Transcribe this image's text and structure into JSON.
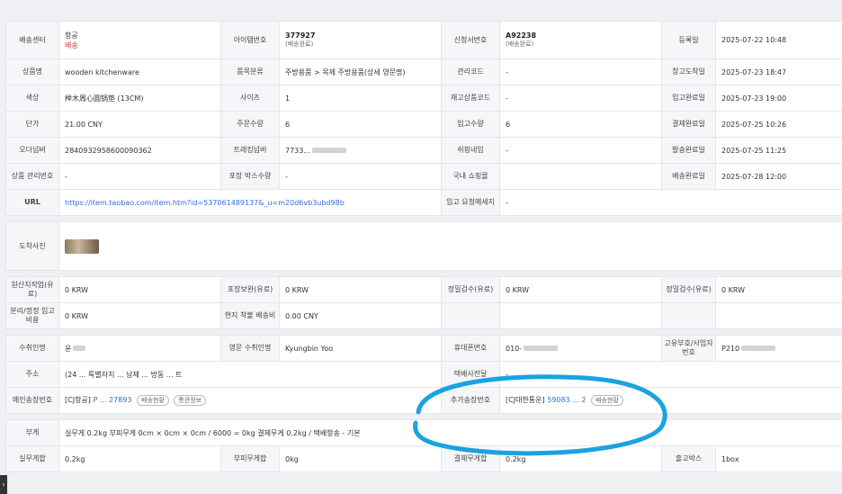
{
  "row1": {
    "center_label": "배송센터",
    "center_v1": "항공",
    "center_v2": "배송",
    "item_label": "아이템번호",
    "item_no": "377927",
    "item_status": "(배송완료)",
    "order_label": "신청서번호",
    "order_no": "A92238",
    "order_status": "(배송완료)",
    "reg_label": "등록일",
    "reg_value": "2025-07-22 10:48"
  },
  "row2": {
    "l1": "상품명",
    "v1": "wooden kitchenware",
    "l2": "품목분류",
    "v2": "주방용품 > 목제 주방용품(상세 영문명)",
    "l3": "관리코드",
    "v3": "-",
    "l4": "창고도착일",
    "v4": "2025-07-23 18:47"
  },
  "row3": {
    "l1": "색상",
    "v1": "榉木周心圆锅垫 (13CM)",
    "l2": "사이즈",
    "v2": "1",
    "l3": "재고상품코드",
    "v3": "-",
    "l4": "입고완료일",
    "v4": "2025-07-23 19:00"
  },
  "row4": {
    "l1": "단가",
    "v1": "21.00 CNY",
    "l2": "주문수량",
    "v2": "6",
    "l3": "입고수량",
    "v3": "6",
    "l4": "결제완료일",
    "v4": "2025-07-25 10:26"
  },
  "row5": {
    "l1": "오더넘버",
    "v1": "2840932958600090362",
    "l2": "트래킹넘버",
    "v2": "7733...",
    "l3": "쉬핑네임",
    "v3": "-",
    "l4": "발송완료일",
    "v4": "2025-07-25 11:25"
  },
  "row6": {
    "l1": "상품 관리번호",
    "v1": "-",
    "l2": "포장 박스수량",
    "v2": "-",
    "l3": "국내 쇼핑몰",
    "v3": "",
    "l4": "배송완료일",
    "v4": "2025-07-28 12:00"
  },
  "row7": {
    "l1": "URL",
    "url": "https://item.taobao.com/item.htm?id=537061489137&_u=m20d6vb3ubd98b",
    "l2": "입고 요청메세지",
    "v2": "-"
  },
  "photo": {
    "label": "도착사진"
  },
  "fees1": {
    "l1": "원산지작업(유료)",
    "v1": "0 KRW",
    "l2": "포장보완(유료)",
    "v2": "0 KRW",
    "l3": "정밀검수(유료)",
    "v3": "0 KRW",
    "l4": "정밀검수(유료)",
    "v4": "0 KRW"
  },
  "fees2": {
    "l1": "분리/정정 입고비용",
    "v1": "0 KRW",
    "l2": "현지 착불 배송비",
    "v2": "0.00 CNY"
  },
  "recv1": {
    "l1": "수취인명",
    "v1": "윤",
    "l2": "영문 수취인명",
    "v2": "Kyungbin Yoo",
    "l3": "휴대폰번호",
    "v3": "010-",
    "l4": "고유부호/사업자번호",
    "v4": "P210"
  },
  "recv2": {
    "l1": "주소",
    "v1": "(24 ... 특별자치 ... 남제 ... 방동 ... 트",
    "l3": "택배사전달",
    "v3": "-"
  },
  "recv3": {
    "l1": "메인송장번호",
    "carrier": "[CJ항공]",
    "tracking": "P ... 27893",
    "chip1": "배송현황",
    "chip2": "통관정보",
    "l3": "추가송장번호",
    "carrier2": "[CJ대한통운]",
    "tracking2": "59083 ... 2",
    "chip3": "배송현황"
  },
  "weight": {
    "label": "부게",
    "value": "실무게 0.2kg 부피무게 0cm × 0cm × 0cm / 6000 = 0kg 결제무게 0.2kg / 택배항송 - 기본"
  },
  "last": {
    "l1": "실무게합",
    "v1": "0.2kg",
    "l2": "부피무게합",
    "v2": "0kg",
    "l3": "결제무게합",
    "v3": "0.2kg",
    "l4": "출고박스",
    "v4": "1box"
  },
  "colors": {
    "accent": "#2e6fd6",
    "annotation": "#1aa3e0",
    "danger": "#e03030"
  },
  "scroll_icon": "chevron-right-icon",
  "scroll_glyph": "›"
}
